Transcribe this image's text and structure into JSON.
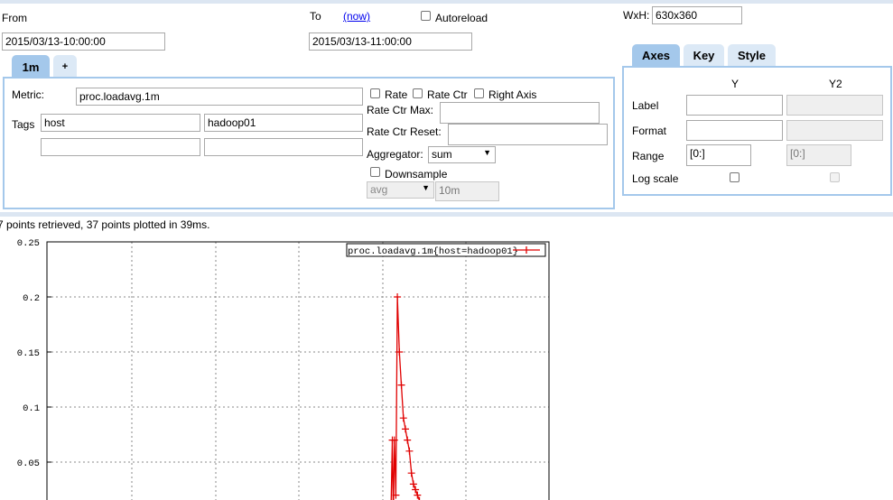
{
  "time": {
    "from_label": "From",
    "from_value": "2015/03/13-10:00:00",
    "to_label": "To",
    "now_link": "(now)",
    "autoreload_label": "Autoreload",
    "to_value": "2015/03/13-11:00:00"
  },
  "size": {
    "label": "WxH:",
    "value": "630x360"
  },
  "metric_tabs": [
    {
      "label": "1m"
    },
    {
      "label": "+"
    }
  ],
  "metric": {
    "label": "Metric:",
    "value": "proc.loadavg.1m",
    "rate_label": "Rate",
    "rate_ctr_label": "Rate Ctr",
    "right_axis_label": "Right Axis",
    "tags_label": "Tags",
    "tags": [
      {
        "key": "host",
        "value": "hadoop01"
      },
      {
        "key": "",
        "value": ""
      }
    ],
    "rate_ctr_max_label": "Rate Ctr Max:",
    "rate_ctr_reset_label": "Rate Ctr Reset:",
    "aggregator_label": "Aggregator:",
    "aggregator_value": "sum",
    "downsample_label": "Downsample",
    "downsample_func": "avg",
    "downsample_interval": "10m"
  },
  "axes_tabs": [
    {
      "label": "Axes"
    },
    {
      "label": "Key"
    },
    {
      "label": "Style"
    }
  ],
  "axes": {
    "y_header": "Y",
    "y2_header": "Y2",
    "label_label": "Label",
    "format_label": "Format",
    "range_label": "Range",
    "range_y": "[0:]",
    "range_y2": "[0:]",
    "log_scale_label": "Log scale"
  },
  "status": "7 points retrieved, 37 points plotted in 39ms.",
  "chart_data": {
    "type": "line",
    "title": "",
    "xlabel": "",
    "ylabel": "",
    "ylim": [
      0,
      0.25
    ],
    "y_ticks": [
      "0.25",
      "0.2",
      "0.15",
      "0.1",
      "0.05"
    ],
    "grid": true,
    "legend_position": "top-right",
    "series": [
      {
        "name": "proc.loadavg.1m{host=hadoop01}",
        "color": "#e00000",
        "points": [
          [
            0.685,
            0.0
          ],
          [
            0.688,
            0.07
          ],
          [
            0.69,
            0.0
          ],
          [
            0.692,
            0.07
          ],
          [
            0.695,
            0.02
          ],
          [
            0.698,
            0.2
          ],
          [
            0.702,
            0.15
          ],
          [
            0.706,
            0.12
          ],
          [
            0.71,
            0.09
          ],
          [
            0.714,
            0.08
          ],
          [
            0.718,
            0.07
          ],
          [
            0.722,
            0.06
          ],
          [
            0.726,
            0.04
          ],
          [
            0.73,
            0.03
          ],
          [
            0.734,
            0.025
          ],
          [
            0.738,
            0.02
          ],
          [
            0.742,
            0.015
          ]
        ]
      }
    ]
  }
}
